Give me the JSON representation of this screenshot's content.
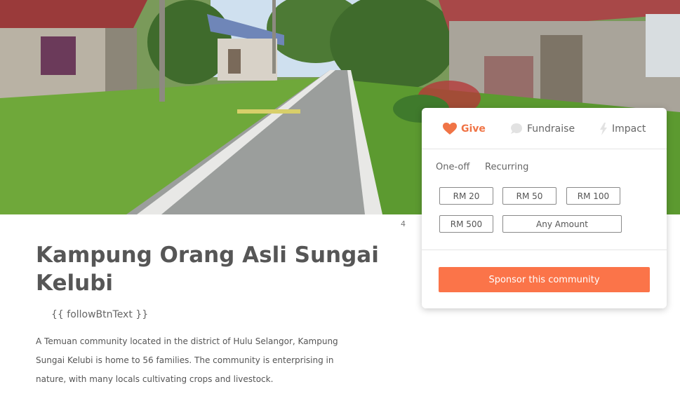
{
  "hero": {
    "icon": "village-road-photo"
  },
  "gallery": {
    "counter": "4"
  },
  "community": {
    "title": "Kampung Orang Asli Sungai Kelubi",
    "follow_text": "{{ followBtnText }}",
    "description": "A Temuan community located in the district of Hulu Selangor, Kampung Sungai Kelubi is home to 56 families. The community is enterprising in nature, with many locals cultivating crops and livestock."
  },
  "donate_card": {
    "tabs": [
      {
        "label": "Give",
        "icon": "heart-icon",
        "active": true
      },
      {
        "label": "Fundraise",
        "icon": "chat-bubble-icon",
        "active": false
      },
      {
        "label": "Impact",
        "icon": "lightning-icon",
        "active": false
      }
    ],
    "frequency": {
      "one_off": "One-off",
      "recurring": "Recurring"
    },
    "amounts": [
      "RM 20",
      "RM 50",
      "RM 100",
      "RM 500",
      "Any Amount"
    ],
    "cta": "Sponsor this community"
  },
  "colors": {
    "accent": "#fb7449",
    "active_tab": "#f07446"
  }
}
